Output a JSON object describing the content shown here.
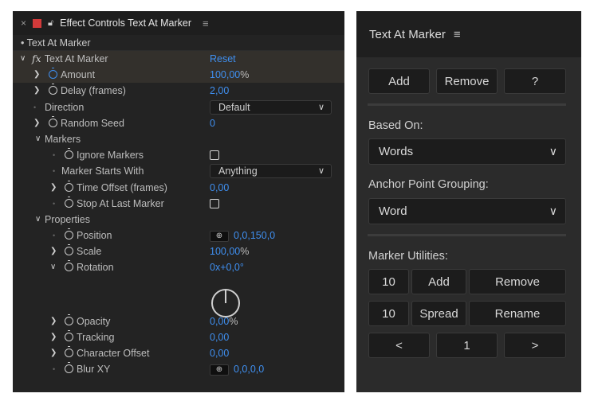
{
  "effect_controls": {
    "tab_close": "×",
    "tab_title": "Effect Controls Text At Marker",
    "tab_menu": "≡",
    "layer_name": "• Text At Marker",
    "effect_name": "Text At Marker",
    "reset": "Reset",
    "amount": {
      "label": "Amount",
      "value": "100,00",
      "unit": "%"
    },
    "delay": {
      "label": "Delay (frames)",
      "value": "2,00"
    },
    "direction": {
      "label": "Direction",
      "value": "Default"
    },
    "random_seed": {
      "label": "Random Seed",
      "value": "0"
    },
    "markers_group": "Markers",
    "ignore_markers": {
      "label": "Ignore Markers",
      "checked": false
    },
    "marker_starts_with": {
      "label": "Marker Starts With",
      "value": "Anything"
    },
    "time_offset": {
      "label": "Time Offset (frames)",
      "value": "0,00"
    },
    "stop_at_last_marker": {
      "label": "Stop At Last Marker",
      "checked": false
    },
    "properties_group": "Properties",
    "position": {
      "label": "Position",
      "value": "0,0,150,0"
    },
    "scale": {
      "label": "Scale",
      "value": "100,00",
      "unit": "%"
    },
    "rotation": {
      "label": "Rotation",
      "value": "0x+0,0°"
    },
    "opacity": {
      "label": "Opacity",
      "value": "0,00",
      "unit": "%"
    },
    "tracking": {
      "label": "Tracking",
      "value": "0,00"
    },
    "character_offset": {
      "label": "Character Offset",
      "value": "0,00"
    },
    "blur_xy": {
      "label": "Blur XY",
      "value": "0,0,0,0"
    }
  },
  "text_at_marker_panel": {
    "title": "Text At Marker",
    "menu": "≡",
    "add": "Add",
    "remove": "Remove",
    "help": "?",
    "based_on_label": "Based On:",
    "based_on_value": "Words",
    "anchor_label": "Anchor Point Grouping:",
    "anchor_value": "Word",
    "marker_utilities_label": "Marker Utilities:",
    "add_count": "10",
    "add_btn": "Add",
    "remove_btn": "Remove",
    "spread_count": "10",
    "spread_btn": "Spread",
    "rename_btn": "Rename",
    "prev": "<",
    "page": "1",
    "next": ">"
  }
}
